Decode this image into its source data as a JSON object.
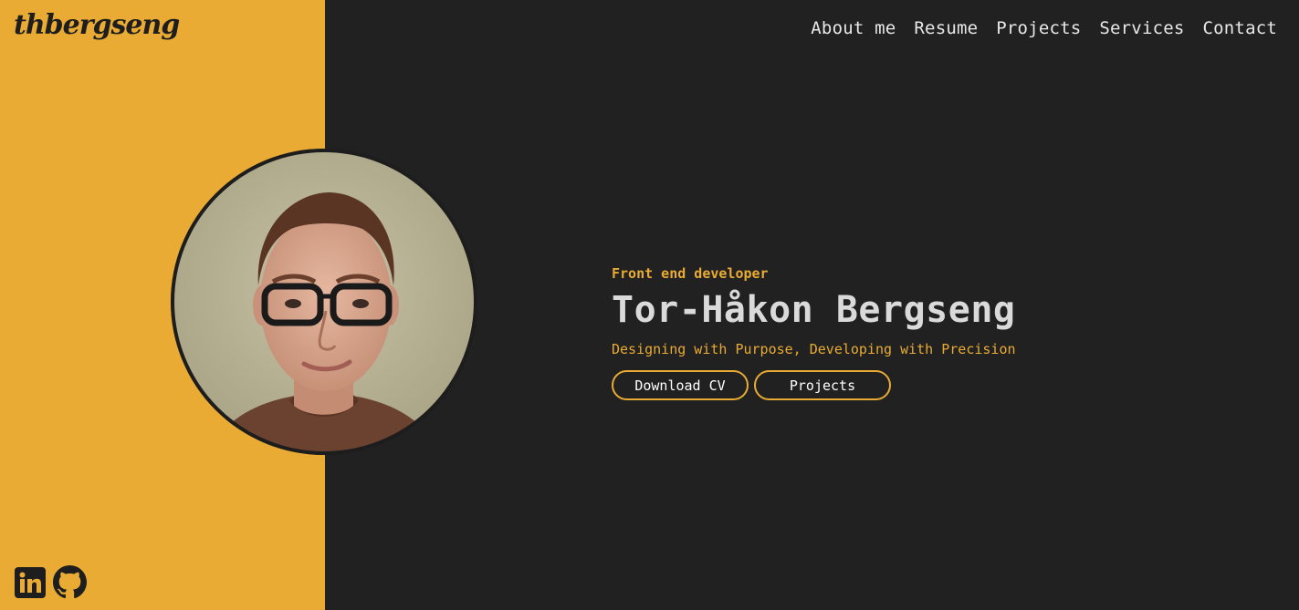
{
  "brand": {
    "logo_text": "thbergseng"
  },
  "nav": {
    "items": [
      {
        "label": "About me"
      },
      {
        "label": "Resume"
      },
      {
        "label": "Projects"
      },
      {
        "label": "Services"
      },
      {
        "label": "Contact"
      }
    ]
  },
  "hero": {
    "eyebrow": "Front end developer",
    "name": "Tor-Håkon Bergseng",
    "tagline": "Designing with Purpose, Developing with Precision",
    "buttons": {
      "download_cv": "Download CV",
      "projects": "Projects"
    },
    "photo_alt": "Portrait of Tor-Håkon Bergseng"
  },
  "socials": {
    "items": [
      {
        "icon": "linkedin-icon"
      },
      {
        "icon": "github-icon"
      }
    ]
  },
  "colors": {
    "accent": "#e9ab34",
    "background": "#212121",
    "heading": "#dadada",
    "nav_text": "#e8e8e8"
  }
}
